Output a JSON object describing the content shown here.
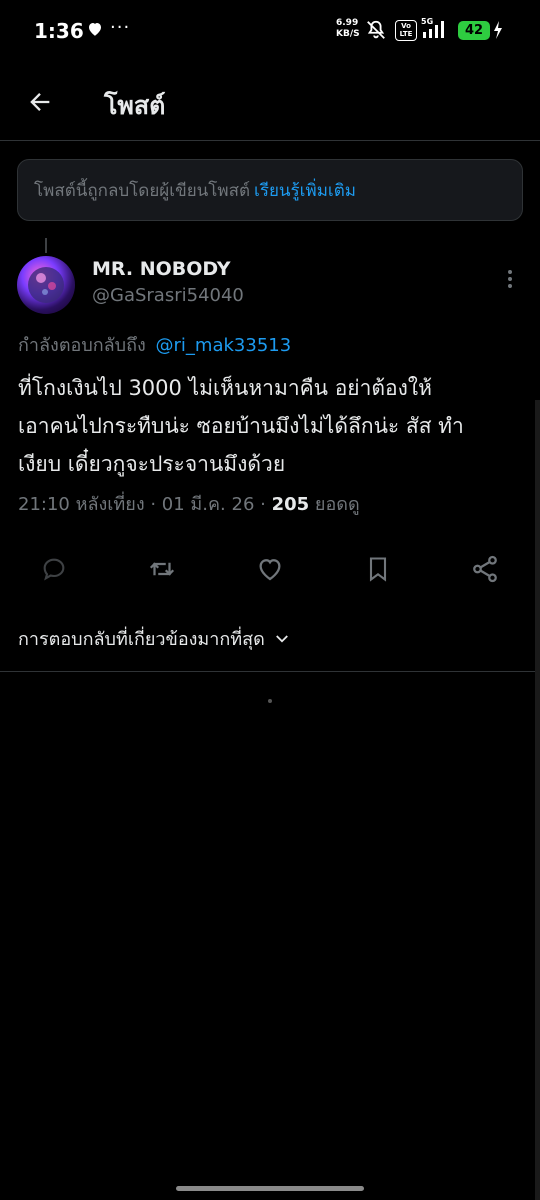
{
  "status_bar": {
    "time": "1:36",
    "more": "···",
    "net_speed_value": "6.99",
    "net_speed_unit": "KB/S",
    "volte": "Vo LTE",
    "network": "5G",
    "battery": "42"
  },
  "header": {
    "title": "โพสต์"
  },
  "notice": {
    "text": "โพสต์นี้ถูกลบโดยผู้เขียนโพสต์",
    "link": "เรียนรู้เพิ่มเติม"
  },
  "post": {
    "display_name": "MR. NOBODY",
    "handle": "@GaSrasri54040",
    "reply_prefix": "กำลังตอบกลับถึง",
    "reply_mention": "@ri_mak33513",
    "body": "ที่โกงเงินไป  3000  ไม่เห็นหามาคืน อย่าต้องให้\nเอาคนไปกระทืบน่ะ ซอยบ้านมึงไม่ได้ลึกน่ะ  สัส ทำ\nเงียบ เดี๋ยวกูจะประจานมึงด้วย",
    "timestamp": "21:10 หลังเที่ยง · 01 มี.ค. 26 ·",
    "views_count": "205",
    "views_label": "ยอดดู"
  },
  "sort": {
    "label": "การตอบกลับที่เกี่ยวข้องมากที่สุด"
  },
  "colors": {
    "background": "#000000",
    "accent": "#1d9bf0",
    "muted_text": "#71767b",
    "primary_text": "#e7e9ea",
    "battery": "#2ecc40"
  }
}
